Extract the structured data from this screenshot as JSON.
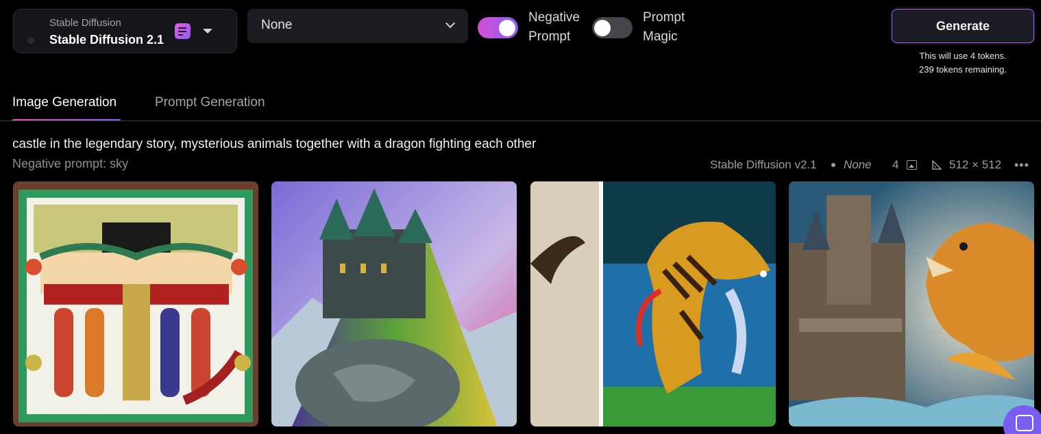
{
  "model_select": {
    "label": "Stable Diffusion",
    "value": "Stable Diffusion 2.1",
    "icon": "prompt-list-icon",
    "accent": "#b45ee8"
  },
  "style_select": {
    "value": "None"
  },
  "toggles": {
    "negative_prompt": {
      "label": "Negative Prompt",
      "on": true
    },
    "prompt_magic": {
      "label": "Prompt Magic",
      "on": false
    }
  },
  "generate": {
    "label": "Generate",
    "note_line1": "This will use 4 tokens.",
    "note_line2": "239 tokens remaining."
  },
  "tabs": [
    {
      "label": "Image Generation",
      "active": true
    },
    {
      "label": "Prompt Generation",
      "active": false
    }
  ],
  "result": {
    "prompt": "castle in the legendary story, mysterious animals together with a dragon fighting each other",
    "negative_prompt": "Negative prompt: sky",
    "model": "Stable Diffusion v2.1",
    "style": "None",
    "count": "4",
    "size": "512 × 512",
    "images": [
      {
        "name": "generated-image-1"
      },
      {
        "name": "generated-image-2"
      },
      {
        "name": "generated-image-3"
      },
      {
        "name": "generated-image-4"
      }
    ]
  },
  "colors": {
    "background": "#000000",
    "accent_pink": "#d450d6",
    "accent_purple": "#8f5cf7"
  }
}
